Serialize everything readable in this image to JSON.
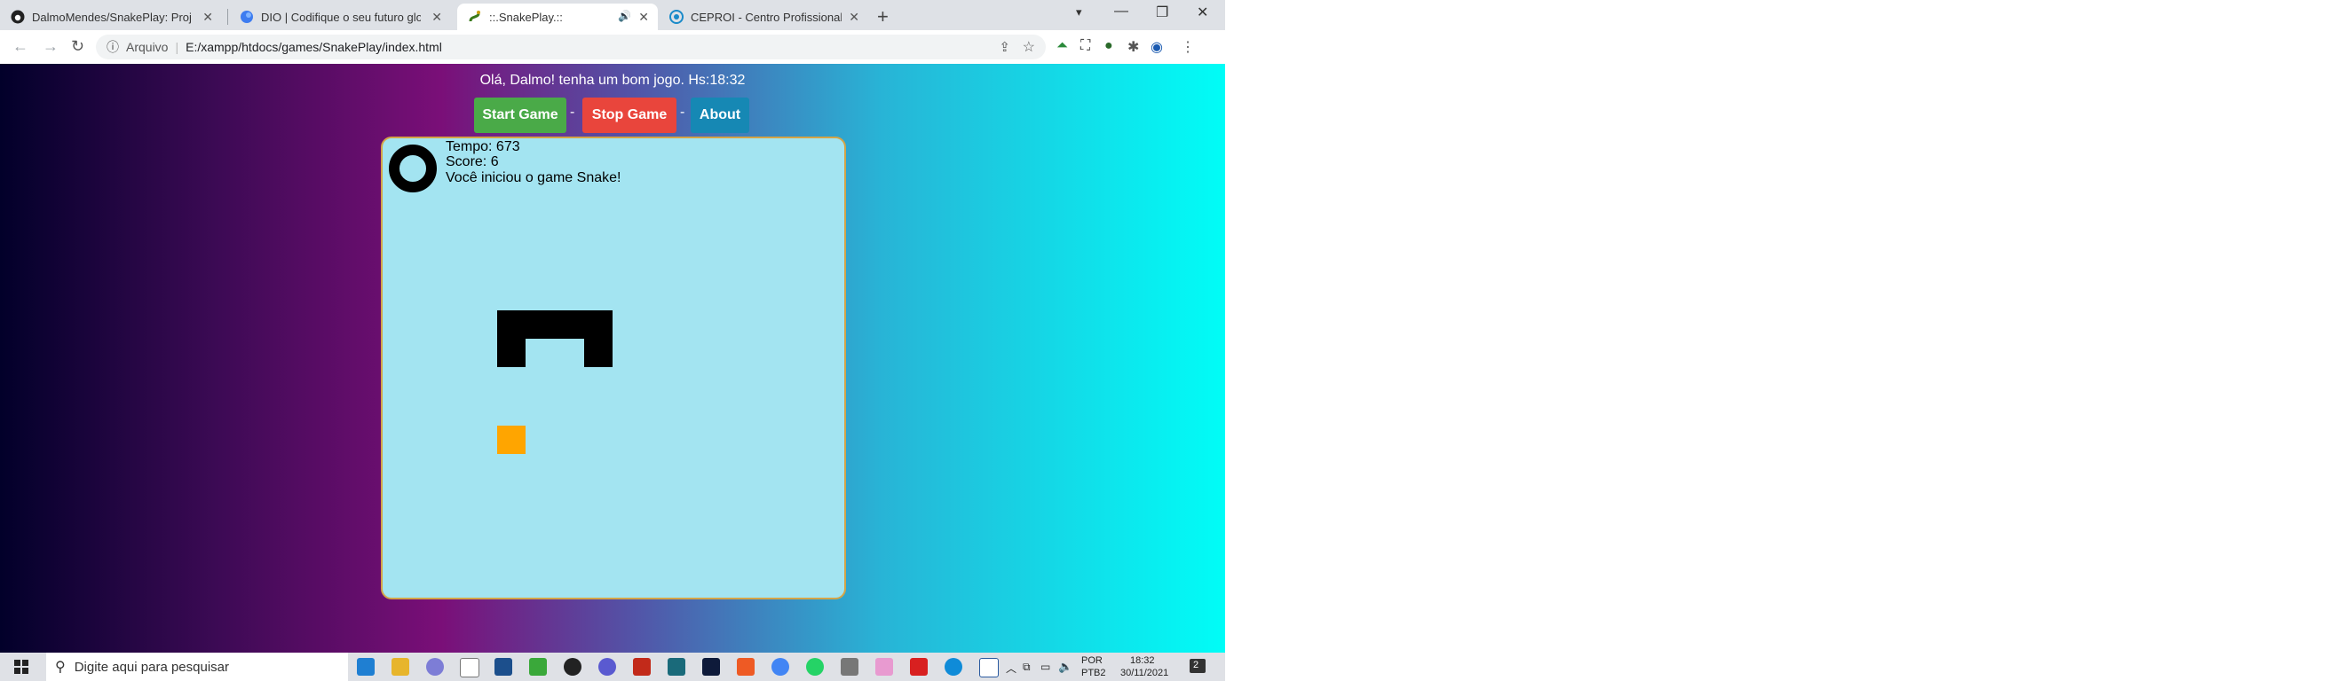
{
  "tabs": [
    {
      "title": "DalmoMendes/SnakePlay: Projet",
      "close": "✕",
      "favicon": "github-icon"
    },
    {
      "title": "DIO | Codifique o seu futuro glob",
      "close": "✕",
      "favicon": "dio-icon"
    },
    {
      "title": "::.SnakePlay.::",
      "close": "✕",
      "favicon": "snake-icon",
      "extra": "🔊"
    },
    {
      "title": "CEPROI - Centro Profissional de I",
      "close": "✕",
      "favicon": "ceproi-icon"
    }
  ],
  "window": {
    "new_tab": "+",
    "minimize": "—",
    "restore": "❐",
    "close": "✕",
    "profile": "▾"
  },
  "toolbar": {
    "back": "←",
    "forward": "→",
    "reload": "↻",
    "info_icon": "ⓘ",
    "protocol_label": "Arquivo",
    "url": "E:/xampp/htdocs/games/SnakePlay/index.html"
  },
  "page": {
    "greeting": "Olá, Dalmo! tenha um bom jogo. Hs:18:32",
    "buttons": [
      {
        "label": "Start Game",
        "color": "#4aaa48"
      },
      {
        "label": "Stop Game",
        "color": "#e9453c"
      },
      {
        "label": "About",
        "color": "#1688b4"
      }
    ],
    "separators": [
      "-",
      "-"
    ],
    "tempo": "Tempo: 673",
    "score": "Score: 6",
    "message": "Você iniciou o game Snake!",
    "snake_color": "#000000",
    "food_color": "#ffa500",
    "board_color": "#a3e4f1"
  },
  "taskbar": {
    "search_placeholder": "Digite aqui para pesquisar",
    "lang_top": "POR",
    "lang_bottom": "PTB2",
    "time": "18:32",
    "date": "30/11/2021",
    "notifications": "2"
  }
}
